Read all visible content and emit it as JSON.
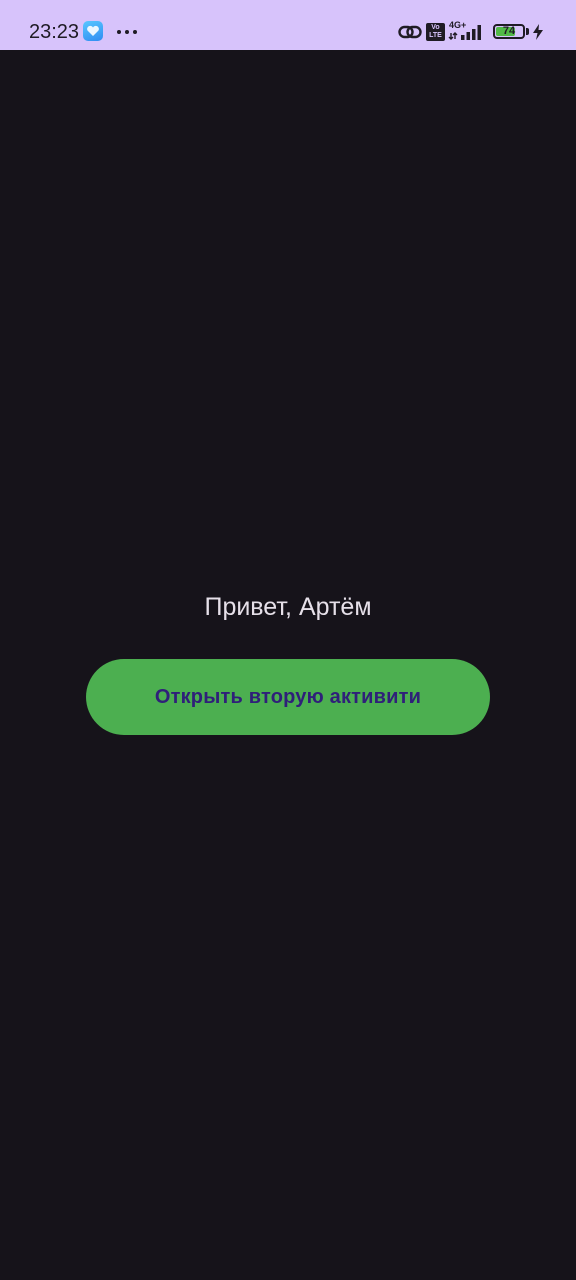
{
  "status_bar": {
    "time": "23:23",
    "volte_line1": "Vo",
    "volte_line2": "LTE",
    "network_type": "4G+",
    "battery_level": "74",
    "battery_fraction": 0.74,
    "icons": [
      "app-badge-icon",
      "more-dots-icon",
      "link-icon",
      "volte-icon",
      "signal-icon",
      "battery-icon",
      "charging-icon"
    ],
    "background_color": "#d7c3fb"
  },
  "main": {
    "greeting": "Привет, Артём",
    "button_label": "Открыть вторую активити",
    "background_color": "#16131a",
    "button_color": "#4caf50",
    "button_text_color": "#2f2079"
  }
}
